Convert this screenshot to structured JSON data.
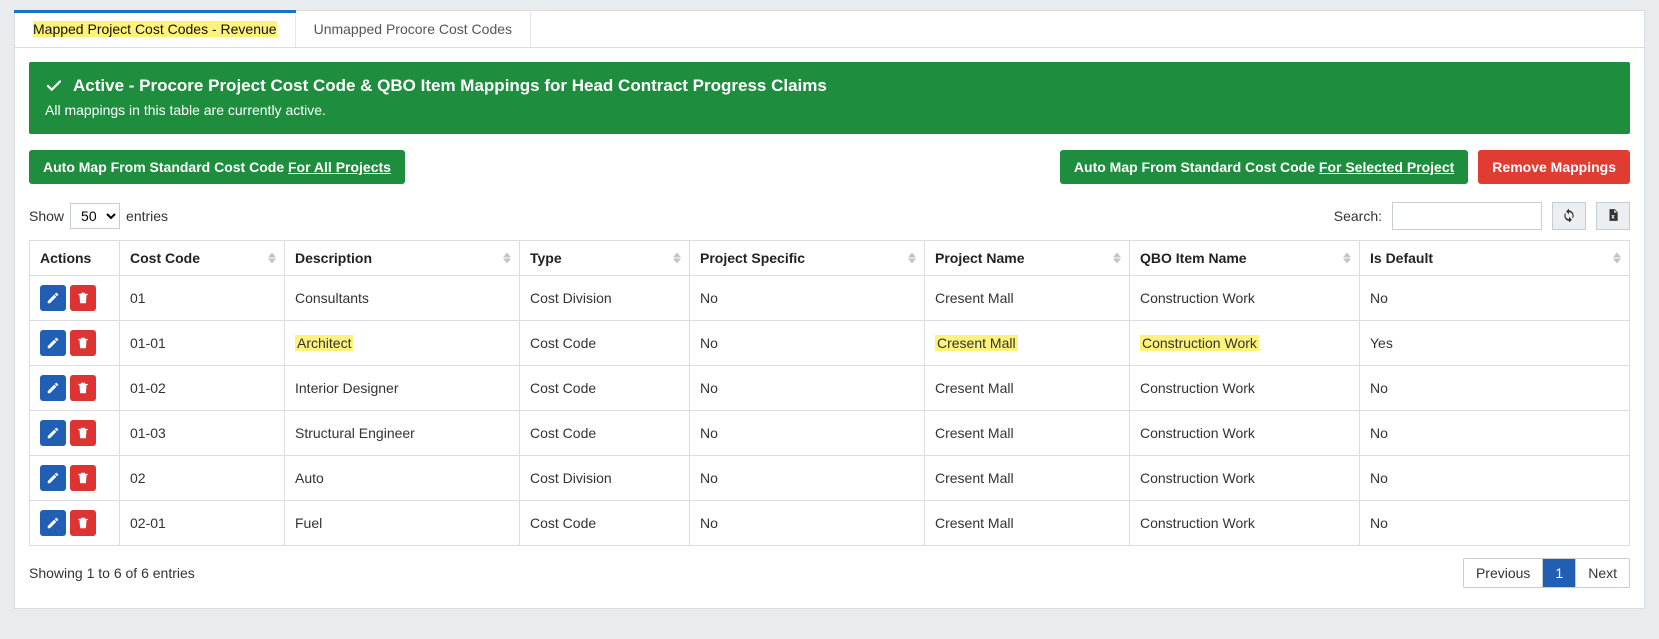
{
  "tabs": {
    "active_label": "Mapped Project Cost Codes - Revenue",
    "inactive_label": "Unmapped Procore Cost Codes"
  },
  "banner": {
    "title": "Active - Procore Project Cost Code & QBO Item Mappings for Head Contract Progress Claims",
    "subtitle": "All mappings in this table are currently active."
  },
  "buttons": {
    "auto_all_prefix": "Auto Map From Standard Cost Code ",
    "auto_all_ul": "For All Projects",
    "auto_sel_prefix": "Auto Map From Standard Cost Code ",
    "auto_sel_ul": "For Selected Project",
    "remove": "Remove Mappings"
  },
  "length": {
    "show": "Show",
    "value": "50",
    "entries": "entries"
  },
  "search_label": "Search:",
  "search_value": "",
  "columns": {
    "actions": "Actions",
    "cost_code": "Cost Code",
    "description": "Description",
    "type": "Type",
    "project_specific": "Project Specific",
    "project_name": "Project Name",
    "qbo_item": "QBO Item Name",
    "is_default": "Is Default"
  },
  "rows": [
    {
      "cost_code": "01",
      "description": "Consultants",
      "description_hl": false,
      "type": "Cost Division",
      "project_specific": "No",
      "project_name": "Cresent Mall",
      "project_name_hl": false,
      "qbo_item": "Construction Work",
      "qbo_item_hl": false,
      "is_default": "No"
    },
    {
      "cost_code": "01-01",
      "description": "Architect",
      "description_hl": true,
      "type": "Cost Code",
      "project_specific": "No",
      "project_name": "Cresent Mall",
      "project_name_hl": true,
      "qbo_item": "Construction Work",
      "qbo_item_hl": true,
      "is_default": "Yes"
    },
    {
      "cost_code": "01-02",
      "description": "Interior Designer",
      "description_hl": false,
      "type": "Cost Code",
      "project_specific": "No",
      "project_name": "Cresent Mall",
      "project_name_hl": false,
      "qbo_item": "Construction Work",
      "qbo_item_hl": false,
      "is_default": "No"
    },
    {
      "cost_code": "01-03",
      "description": "Structural Engineer",
      "description_hl": false,
      "type": "Cost Code",
      "project_specific": "No",
      "project_name": "Cresent Mall",
      "project_name_hl": false,
      "qbo_item": "Construction Work",
      "qbo_item_hl": false,
      "is_default": "No"
    },
    {
      "cost_code": "02",
      "description": "Auto",
      "description_hl": false,
      "type": "Cost Division",
      "project_specific": "No",
      "project_name": "Cresent Mall",
      "project_name_hl": false,
      "qbo_item": "Construction Work",
      "qbo_item_hl": false,
      "is_default": "No"
    },
    {
      "cost_code": "02-01",
      "description": "Fuel",
      "description_hl": false,
      "type": "Cost Code",
      "project_specific": "No",
      "project_name": "Cresent Mall",
      "project_name_hl": false,
      "qbo_item": "Construction Work",
      "qbo_item_hl": false,
      "is_default": "No"
    }
  ],
  "info_text": "Showing 1 to 6 of 6 entries",
  "pager": {
    "prev": "Previous",
    "page": "1",
    "next": "Next"
  }
}
